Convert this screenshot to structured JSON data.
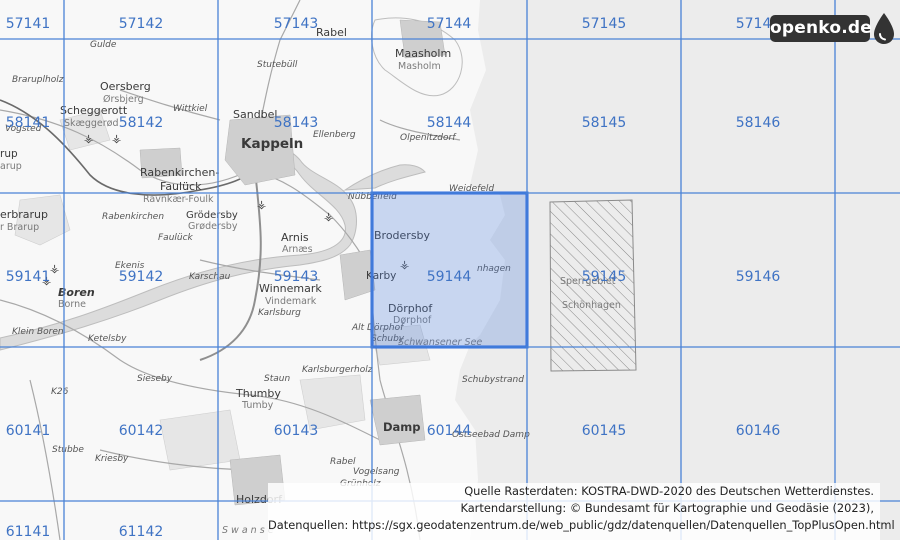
{
  "grid": {
    "cells": [
      {
        "id": "57141",
        "col": 0,
        "row": 0
      },
      {
        "id": "57142",
        "col": 1,
        "row": 0
      },
      {
        "id": "57143",
        "col": 2,
        "row": 0
      },
      {
        "id": "57144",
        "col": 3,
        "row": 0
      },
      {
        "id": "57145",
        "col": 4,
        "row": 0
      },
      {
        "id": "57146",
        "col": 5,
        "row": 0
      },
      {
        "id": "58141",
        "col": 0,
        "row": 1
      },
      {
        "id": "58142",
        "col": 1,
        "row": 1
      },
      {
        "id": "58143",
        "col": 2,
        "row": 1
      },
      {
        "id": "58144",
        "col": 3,
        "row": 1
      },
      {
        "id": "58145",
        "col": 4,
        "row": 1
      },
      {
        "id": "58146",
        "col": 5,
        "row": 1
      },
      {
        "id": "59141",
        "col": 0,
        "row": 2
      },
      {
        "id": "59142",
        "col": 1,
        "row": 2
      },
      {
        "id": "59143",
        "col": 2,
        "row": 2
      },
      {
        "id": "59144",
        "col": 3,
        "row": 2
      },
      {
        "id": "59145",
        "col": 4,
        "row": 2
      },
      {
        "id": "59146",
        "col": 5,
        "row": 2
      },
      {
        "id": "60141",
        "col": 0,
        "row": 3
      },
      {
        "id": "60142",
        "col": 1,
        "row": 3
      },
      {
        "id": "60143",
        "col": 2,
        "row": 3
      },
      {
        "id": "60144",
        "col": 3,
        "row": 3
      },
      {
        "id": "60145",
        "col": 4,
        "row": 3
      },
      {
        "id": "60146",
        "col": 5,
        "row": 3
      },
      {
        "id": "61141",
        "col": 0,
        "row": 4
      },
      {
        "id": "61142",
        "col": 1,
        "row": 4
      }
    ],
    "selected": "59144",
    "line_color": "#4a82d6",
    "selected_fill": "#4a7fdc",
    "label_color": "#3f73c4"
  },
  "places": {
    "kappeln": "Kappeln",
    "maasholm": "Maasholm",
    "maasholm_sub": "Masholm",
    "rabel": "Rabel",
    "gulde": "Gulde",
    "oersberg": "Oersberg",
    "oersberg_sub": "Ørsbjerg",
    "braruplholz": "Braruplholz",
    "scheggerott": "Scheggerott",
    "scheggerott_sub": "Skæggerød",
    "wittkiel": "Wittkiel",
    "stutebull": "Stutebüll",
    "sandbek": "Sandbel",
    "ellenberg": "Ellenberg",
    "olpenitzdorf": "Olpenitzdorf",
    "rabenkirchen": "Rabenkirchen-",
    "fauluck": "Faulück",
    "rabenkirchen_sub": "Ravnkær-Foulk",
    "grodersby": "Grödersby",
    "grodersby_sub": "Grødersby",
    "arnis": "Arnis",
    "arnis_sub": "Arnæs",
    "nubbelfeld": "Nübbelfeld",
    "weidefeld": "Weidefeld",
    "brodersby": "Brodersby",
    "karby": "Karby",
    "schonhagen": "nhagen",
    "winnemark": "Winnemark",
    "winnemark_sub": "Vindemark",
    "karlsburg": "Karlsburg",
    "karschau": "Karschau",
    "dorphof": "Dörphof",
    "dorphof_sub": "Dørphof",
    "alt_dorphof": "Alt Dörphof",
    "schuby": "Schuby",
    "schwansener_see": "Schwansener See",
    "boren": "Boren",
    "boren_sub": "Borne",
    "klein_boren": "Klein Boren",
    "ketelsby": "Ketelsby",
    "sieseby": "Sieseby",
    "thumby": "Thumby",
    "thumby_sub": "Tumby",
    "staun": "Staun",
    "karlsburgerholz": "Karlsburgerholz",
    "schubystrand": "Schubystrand",
    "damp": "Damp",
    "ostseebad_damp": "Ostseebad Damp",
    "rabel_lower": "Rabel",
    "vogelsang": "Vogelsang",
    "grunholz": "Grünholz",
    "holzdorf": "Holzdorf",
    "stubbe": "Stubbe",
    "kriesby": "Kriesby",
    "erbrarup": "erbrarup",
    "erbrarup_sub": "r Brarup",
    "rup": "rup",
    "rup_sub": "arup",
    "vogsted": "Vogsted",
    "sperrgebiet": "Sperrgebiet",
    "schonhagen_area": "Schönhagen",
    "ekenis": "Ekenis",
    "rabenkirchen_small": "Rabenkirchen",
    "kius": "Kius",
    "fauluck_small": "Faulück",
    "kappeln_bottom": "S  w  a  n  s  e",
    "k26": "K26"
  },
  "logo": {
    "text": "openko.de",
    "icon": "drop-icon"
  },
  "credits": {
    "line1": "Quelle Rasterdaten: KOSTRA-DWD-2020 des Deutschen Wetterdienstes.",
    "line2": "Kartendarstellung: © Bundesamt für Kartographie und Geodäsie (2023),",
    "line3": "Datenquellen: https://sgx.geodatenzentrum.de/web_public/gdz/datenquellen/Datenquellen_TopPlusOpen.html"
  }
}
